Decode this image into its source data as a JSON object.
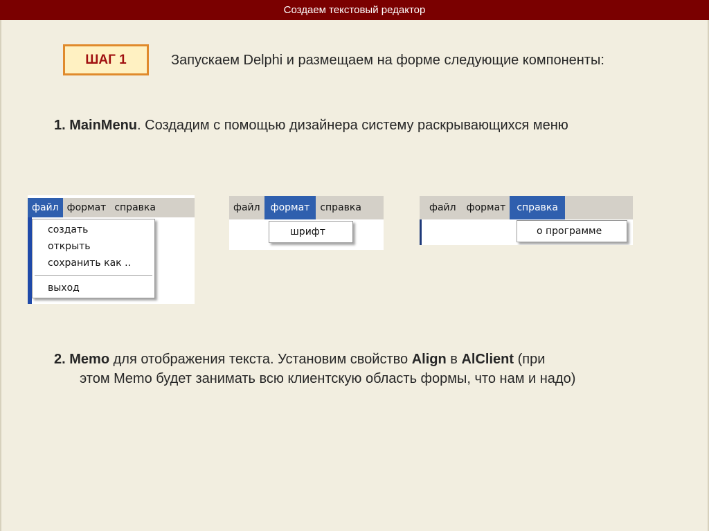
{
  "header": {
    "title": "Создаем текстовый редактор"
  },
  "step": {
    "label": "ШАГ 1"
  },
  "intro": {
    "text": "Запускаем Delphi и размещаем на форме следующие компоненты:"
  },
  "item1": {
    "number": "1.",
    "component": "MainMenu",
    "text": ". Создадим с помощью дизайнера систему раскрывающихся меню"
  },
  "menus": {
    "file_label": "файл",
    "format_label": "формат",
    "help_label": "справка",
    "file_items": [
      "создать",
      "открыть",
      "сохранить как ..",
      "выход"
    ],
    "format_items": [
      "шрифт"
    ],
    "help_items": [
      "о программе"
    ]
  },
  "item2": {
    "number": "2.",
    "component": "Memo",
    "text_a": " для отображения текста. Установим свойство ",
    "property": "Align",
    "text_b": " в ",
    "value": "AlClient",
    "text_c": " (при",
    "continuation": "этом Memo будет занимать всю клиентскую область формы, что нам и надо)"
  },
  "colors": {
    "title_bar": "#7a0000",
    "background": "#f2eee0",
    "badge_border": "#e08a2c",
    "badge_fill": "#fff1c2",
    "menu_highlight": "#2f5fae"
  }
}
